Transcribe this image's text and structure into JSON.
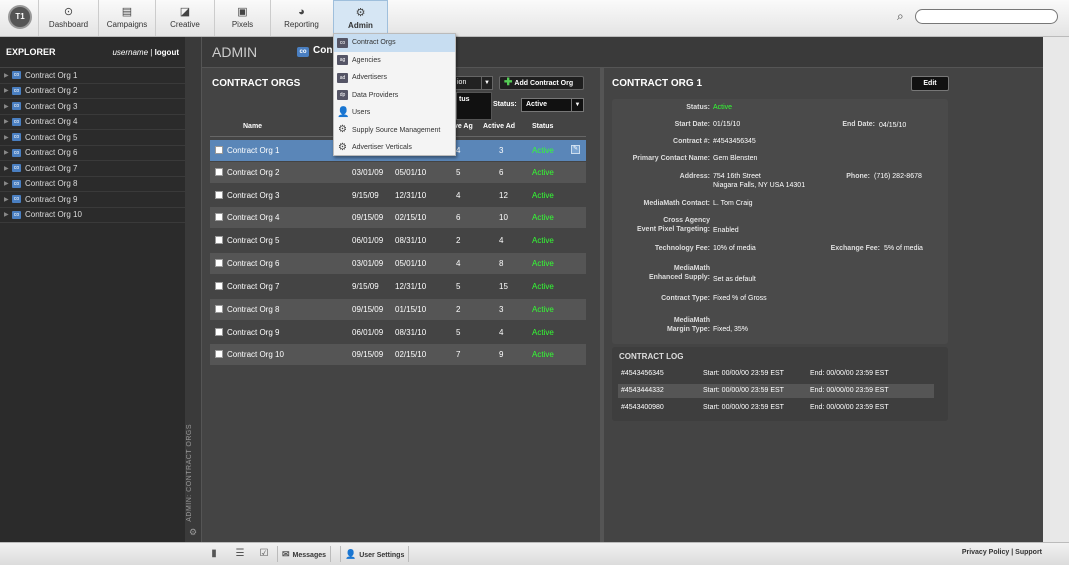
{
  "app": {
    "logo": "T1"
  },
  "nav": [
    {
      "label": "Dashboard",
      "icon": "dashboard-icon",
      "glyph": "⊙"
    },
    {
      "label": "Campaigns",
      "icon": "campaigns-icon",
      "glyph": "▤"
    },
    {
      "label": "Creative",
      "icon": "creative-icon",
      "glyph": "◪"
    },
    {
      "label": "Pixels",
      "icon": "pixels-icon",
      "glyph": "▣"
    },
    {
      "label": "Reporting",
      "icon": "reporting-icon",
      "glyph": "◕"
    },
    {
      "label": "Admin",
      "icon": "gear-icon",
      "glyph": "⚙"
    }
  ],
  "search": {
    "placeholder": ""
  },
  "explorer": {
    "title": "EXPLORER",
    "username": "username",
    "separator": "|",
    "logout": "logout",
    "items": [
      "Contract Org 1",
      "Contract Org 2",
      "Contract Org 3",
      "Contract Org 4",
      "Contract Org 5",
      "Contract Org 6",
      "Contract Org 7",
      "Contract Org 8",
      "Contract Org 9",
      "Contract Org 10"
    ],
    "vertical_label": "ADMIN: CONTRACT ORGS"
  },
  "admin_header": {
    "title": "ADMIN",
    "crumb": "Con"
  },
  "admin_menu": [
    {
      "badge": "co",
      "label": "Contract Orgs"
    },
    {
      "badge": "ag",
      "label": "Agencies"
    },
    {
      "badge": "ad",
      "label": "Advertisers"
    },
    {
      "badge": "dp",
      "label": "Data Providers"
    },
    {
      "badge": "👤",
      "label": "Users"
    },
    {
      "badge": "⚙",
      "label": "Supply Source Management"
    },
    {
      "badge": "⚙",
      "label": "Advertiser Verticals"
    }
  ],
  "list": {
    "title": "CONTRACT ORGS",
    "filter_label": "ion",
    "add_button": "Add Contract Org",
    "status_label": "Status:",
    "status_value": "Active",
    "popover_text": "tus",
    "columns": [
      "Name",
      "ive Ag",
      "Active Ad",
      "Status"
    ],
    "rows": [
      {
        "name": "Contract Org 1",
        "start": "",
        "end": "",
        "ag": "4",
        "ad": "3",
        "status": "Active"
      },
      {
        "name": "Contract Org 2",
        "start": "03/01/09",
        "end": "05/01/10",
        "ag": "5",
        "ad": "6",
        "status": "Active"
      },
      {
        "name": "Contract Org 3",
        "start": "9/15/09",
        "end": "12/31/10",
        "ag": "4",
        "ad": "12",
        "status": "Active"
      },
      {
        "name": "Contract Org 4",
        "start": "09/15/09",
        "end": "02/15/10",
        "ag": "6",
        "ad": "10",
        "status": "Active"
      },
      {
        "name": "Contract Org 5",
        "start": "06/01/09",
        "end": "08/31/10",
        "ag": "2",
        "ad": "4",
        "status": "Active"
      },
      {
        "name": "Contract Org 6",
        "start": "03/01/09",
        "end": "05/01/10",
        "ag": "4",
        "ad": "8",
        "status": "Active"
      },
      {
        "name": "Contract Org 7",
        "start": "9/15/09",
        "end": "12/31/10",
        "ag": "5",
        "ad": "15",
        "status": "Active"
      },
      {
        "name": "Contract Org 8",
        "start": "09/15/09",
        "end": "01/15/10",
        "ag": "2",
        "ad": "3",
        "status": "Active"
      },
      {
        "name": "Contract Org 9",
        "start": "06/01/09",
        "end": "08/31/10",
        "ag": "5",
        "ad": "4",
        "status": "Active"
      },
      {
        "name": "Contract Org 10",
        "start": "09/15/09",
        "end": "02/15/10",
        "ag": "7",
        "ad": "9",
        "status": "Active"
      }
    ]
  },
  "detail": {
    "title": "CONTRACT ORG 1",
    "edit": "Edit",
    "status_label": "Status:",
    "status": "Active",
    "start_label": "Start Date:",
    "start": "01/15/10",
    "end_label": "End Date:",
    "end": "04/15/10",
    "contract_label": "Contract #:",
    "contract": "#4543456345",
    "contact_label": "Primary Contact Name:",
    "contact": "Gem Blensten",
    "address_label": "Address:",
    "address1": "754 16th Street",
    "address2": "Niagara Falls, NY USA 14301",
    "phone_label": "Phone:",
    "phone": "(716) 282-8678",
    "mm_contact_label": "MediaMath Contact:",
    "mm_contact": "L. Tom Craig",
    "cross_label1": "Cross Agency",
    "cross_label2": "Event Pixel Targeting:",
    "cross": "Enabled",
    "tech_label": "Technology Fee:",
    "tech": "10% of media",
    "exch_label": "Exchange Fee:",
    "exch": "5% of media",
    "enh_label1": "MediaMath",
    "enh_label2": "Enhanced Supply:",
    "enh": "Set as default",
    "type_label": "Contract Type:",
    "type": "Fixed % of Gross",
    "margin_label1": "MediaMath",
    "margin_label2": "Margin Type:",
    "margin": "Fixed, 35%"
  },
  "contract_log": {
    "title": "CONTRACT LOG",
    "rows": [
      {
        "id": "#4543456345",
        "start": "Start: 00/00/00 23:59 EST",
        "end": "End: 00/00/00 23:59 EST"
      },
      {
        "id": "#4543444332",
        "start": "Start: 00/00/00 23:59 EST",
        "end": "End: 00/00/00 23:59 EST"
      },
      {
        "id": "#4543400980",
        "start": "Start: 00/00/00 23:59 EST",
        "end": "End: 00/00/00 23:59 EST"
      }
    ]
  },
  "footer": {
    "messages": "Messages",
    "user_settings": "User Settings",
    "privacy": "Privacy Policy",
    "sep": "|",
    "support": "Support"
  },
  "colors": {
    "active_green": "#33ff33",
    "selected_row": "#5a86b8",
    "menu_highlight": "#c7ddf1"
  }
}
